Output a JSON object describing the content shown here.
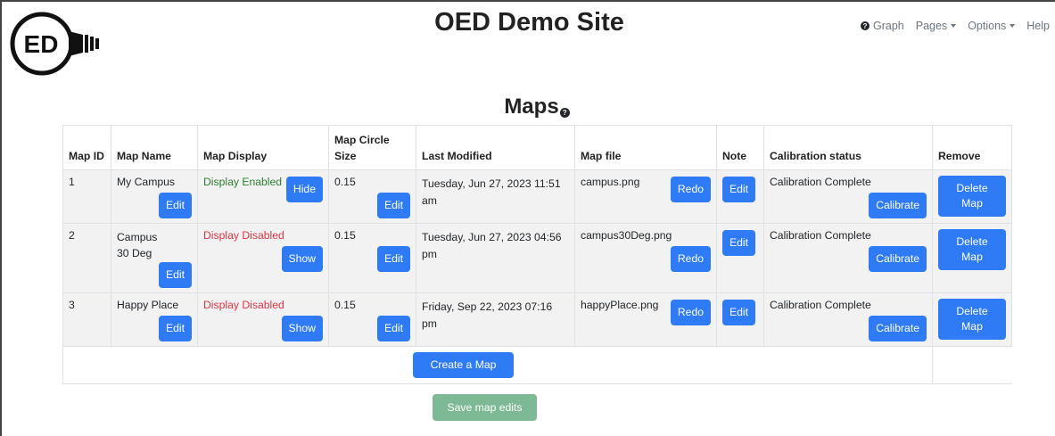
{
  "site": {
    "logo_text": "ED",
    "title": "OED Demo Site"
  },
  "nav": {
    "graph": "Graph",
    "pages": "Pages",
    "options": "Options",
    "help": "Help"
  },
  "page": {
    "title": "Maps"
  },
  "table": {
    "headers": [
      "Map ID",
      "Map Name",
      "Map Display",
      "Map Circle Size",
      "Last Modified",
      "Map file",
      "Note",
      "Calibration status",
      "Remove"
    ],
    "rows": [
      {
        "id": "1",
        "name": "My Campus",
        "display": "Display Enabled",
        "display_state": "enabled",
        "toggle": "Hide",
        "circle": "0.15",
        "modified": "Tuesday, Jun 27, 2023 11:51 am",
        "file": "campus.png",
        "calibration": "Calibration Complete"
      },
      {
        "id": "2",
        "name": "Campus 30 Deg",
        "display": "Display Disabled",
        "display_state": "disabled",
        "toggle": "Show",
        "circle": "0.15",
        "modified": "Tuesday, Jun 27, 2023 04:56 pm",
        "file": "campus30Deg.png",
        "calibration": "Calibration Complete"
      },
      {
        "id": "3",
        "name": "Happy Place",
        "display": "Display Disabled",
        "display_state": "disabled",
        "toggle": "Show",
        "circle": "0.15",
        "modified": "Friday, Sep 22, 2023 07:16 pm",
        "file": "happyPlace.png",
        "calibration": "Calibration Complete"
      }
    ],
    "labels": {
      "edit": "Edit",
      "redo": "Redo",
      "calibrate": "Calibrate",
      "delete": "Delete Map"
    }
  },
  "actions": {
    "create": "Create a Map",
    "save": "Save map edits"
  },
  "colors": {
    "primary": "#2f7bf5",
    "enabled": "#2e7d32",
    "disabled": "#dc3545",
    "save": "#7cb994"
  }
}
